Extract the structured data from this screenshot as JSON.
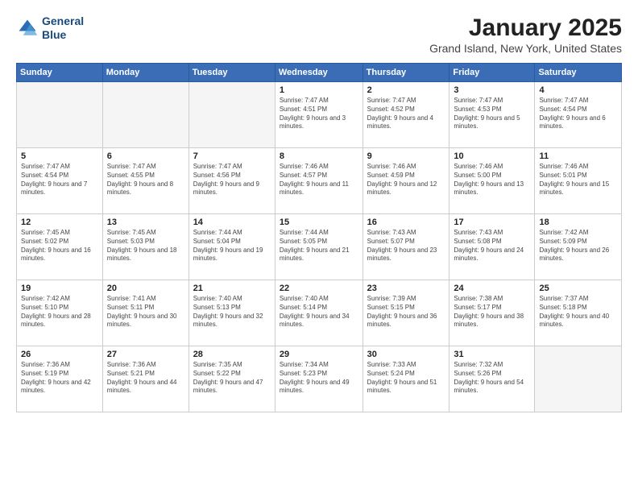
{
  "header": {
    "logo_line1": "General",
    "logo_line2": "Blue",
    "month": "January 2025",
    "location": "Grand Island, New York, United States"
  },
  "weekdays": [
    "Sunday",
    "Monday",
    "Tuesday",
    "Wednesday",
    "Thursday",
    "Friday",
    "Saturday"
  ],
  "weeks": [
    [
      {
        "day": "",
        "info": ""
      },
      {
        "day": "",
        "info": ""
      },
      {
        "day": "",
        "info": ""
      },
      {
        "day": "1",
        "info": "Sunrise: 7:47 AM\nSunset: 4:51 PM\nDaylight: 9 hours and 3 minutes."
      },
      {
        "day": "2",
        "info": "Sunrise: 7:47 AM\nSunset: 4:52 PM\nDaylight: 9 hours and 4 minutes."
      },
      {
        "day": "3",
        "info": "Sunrise: 7:47 AM\nSunset: 4:53 PM\nDaylight: 9 hours and 5 minutes."
      },
      {
        "day": "4",
        "info": "Sunrise: 7:47 AM\nSunset: 4:54 PM\nDaylight: 9 hours and 6 minutes."
      }
    ],
    [
      {
        "day": "5",
        "info": "Sunrise: 7:47 AM\nSunset: 4:54 PM\nDaylight: 9 hours and 7 minutes."
      },
      {
        "day": "6",
        "info": "Sunrise: 7:47 AM\nSunset: 4:55 PM\nDaylight: 9 hours and 8 minutes."
      },
      {
        "day": "7",
        "info": "Sunrise: 7:47 AM\nSunset: 4:56 PM\nDaylight: 9 hours and 9 minutes."
      },
      {
        "day": "8",
        "info": "Sunrise: 7:46 AM\nSunset: 4:57 PM\nDaylight: 9 hours and 11 minutes."
      },
      {
        "day": "9",
        "info": "Sunrise: 7:46 AM\nSunset: 4:59 PM\nDaylight: 9 hours and 12 minutes."
      },
      {
        "day": "10",
        "info": "Sunrise: 7:46 AM\nSunset: 5:00 PM\nDaylight: 9 hours and 13 minutes."
      },
      {
        "day": "11",
        "info": "Sunrise: 7:46 AM\nSunset: 5:01 PM\nDaylight: 9 hours and 15 minutes."
      }
    ],
    [
      {
        "day": "12",
        "info": "Sunrise: 7:45 AM\nSunset: 5:02 PM\nDaylight: 9 hours and 16 minutes."
      },
      {
        "day": "13",
        "info": "Sunrise: 7:45 AM\nSunset: 5:03 PM\nDaylight: 9 hours and 18 minutes."
      },
      {
        "day": "14",
        "info": "Sunrise: 7:44 AM\nSunset: 5:04 PM\nDaylight: 9 hours and 19 minutes."
      },
      {
        "day": "15",
        "info": "Sunrise: 7:44 AM\nSunset: 5:05 PM\nDaylight: 9 hours and 21 minutes."
      },
      {
        "day": "16",
        "info": "Sunrise: 7:43 AM\nSunset: 5:07 PM\nDaylight: 9 hours and 23 minutes."
      },
      {
        "day": "17",
        "info": "Sunrise: 7:43 AM\nSunset: 5:08 PM\nDaylight: 9 hours and 24 minutes."
      },
      {
        "day": "18",
        "info": "Sunrise: 7:42 AM\nSunset: 5:09 PM\nDaylight: 9 hours and 26 minutes."
      }
    ],
    [
      {
        "day": "19",
        "info": "Sunrise: 7:42 AM\nSunset: 5:10 PM\nDaylight: 9 hours and 28 minutes."
      },
      {
        "day": "20",
        "info": "Sunrise: 7:41 AM\nSunset: 5:11 PM\nDaylight: 9 hours and 30 minutes."
      },
      {
        "day": "21",
        "info": "Sunrise: 7:40 AM\nSunset: 5:13 PM\nDaylight: 9 hours and 32 minutes."
      },
      {
        "day": "22",
        "info": "Sunrise: 7:40 AM\nSunset: 5:14 PM\nDaylight: 9 hours and 34 minutes."
      },
      {
        "day": "23",
        "info": "Sunrise: 7:39 AM\nSunset: 5:15 PM\nDaylight: 9 hours and 36 minutes."
      },
      {
        "day": "24",
        "info": "Sunrise: 7:38 AM\nSunset: 5:17 PM\nDaylight: 9 hours and 38 minutes."
      },
      {
        "day": "25",
        "info": "Sunrise: 7:37 AM\nSunset: 5:18 PM\nDaylight: 9 hours and 40 minutes."
      }
    ],
    [
      {
        "day": "26",
        "info": "Sunrise: 7:36 AM\nSunset: 5:19 PM\nDaylight: 9 hours and 42 minutes."
      },
      {
        "day": "27",
        "info": "Sunrise: 7:36 AM\nSunset: 5:21 PM\nDaylight: 9 hours and 44 minutes."
      },
      {
        "day": "28",
        "info": "Sunrise: 7:35 AM\nSunset: 5:22 PM\nDaylight: 9 hours and 47 minutes."
      },
      {
        "day": "29",
        "info": "Sunrise: 7:34 AM\nSunset: 5:23 PM\nDaylight: 9 hours and 49 minutes."
      },
      {
        "day": "30",
        "info": "Sunrise: 7:33 AM\nSunset: 5:24 PM\nDaylight: 9 hours and 51 minutes."
      },
      {
        "day": "31",
        "info": "Sunrise: 7:32 AM\nSunset: 5:26 PM\nDaylight: 9 hours and 54 minutes."
      },
      {
        "day": "",
        "info": ""
      }
    ]
  ]
}
